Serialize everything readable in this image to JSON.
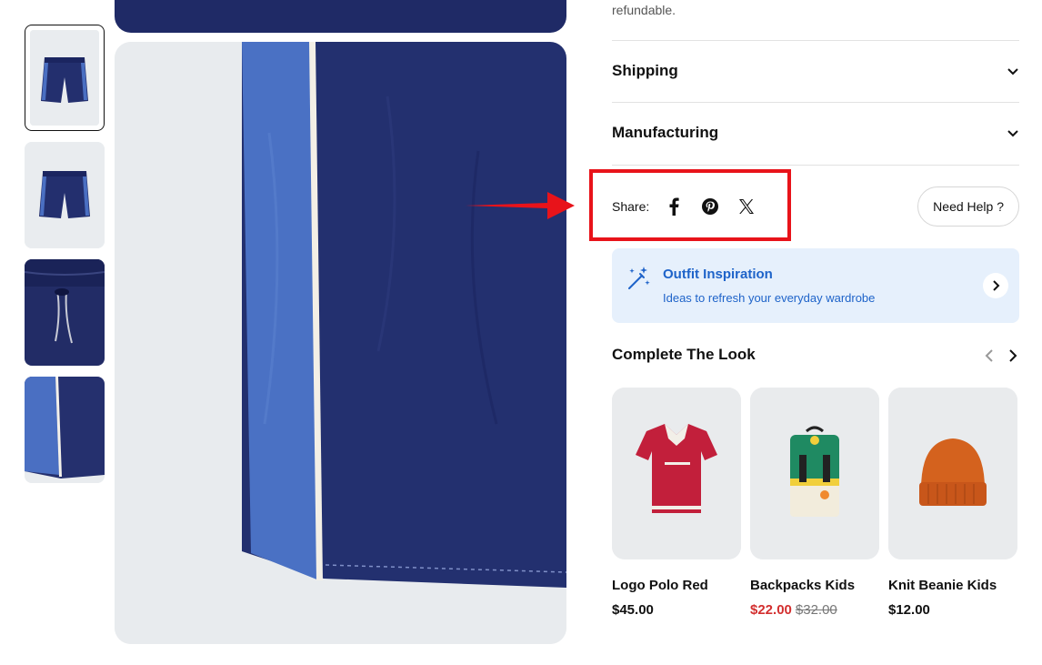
{
  "gallery": {
    "thumbnails": [
      {
        "name": "shorts-front"
      },
      {
        "name": "shorts-angle"
      },
      {
        "name": "waistband-closeup"
      },
      {
        "name": "side-stripe-closeup"
      }
    ],
    "active_index": 0
  },
  "details": {
    "refundable_text": "refundable.",
    "accordions": [
      {
        "label": "Shipping"
      },
      {
        "label": "Manufacturing"
      }
    ]
  },
  "share": {
    "label": "Share:",
    "icons": [
      "facebook-icon",
      "pinterest-icon",
      "x-twitter-icon"
    ],
    "help_label": "Need Help ?"
  },
  "inspiration": {
    "title": "Outfit Inspiration",
    "subtitle": "Ideas to refresh your everyday wardrobe"
  },
  "complete_look": {
    "title": "Complete The Look",
    "products": [
      {
        "name": "Logo Polo Red",
        "price": "$45.00",
        "sale_price": "",
        "old_price": ""
      },
      {
        "name": "Backpacks Kids",
        "price": "",
        "sale_price": "$22.00",
        "old_price": "$32.00"
      },
      {
        "name": "Knit Beanie Kids",
        "price": "$12.00",
        "sale_price": "",
        "old_price": ""
      }
    ]
  },
  "colors": {
    "accent_blue": "#1e63c9",
    "sale_red": "#d32f2f",
    "highlight_red": "#e8131a",
    "navy": "#1f2a66"
  }
}
